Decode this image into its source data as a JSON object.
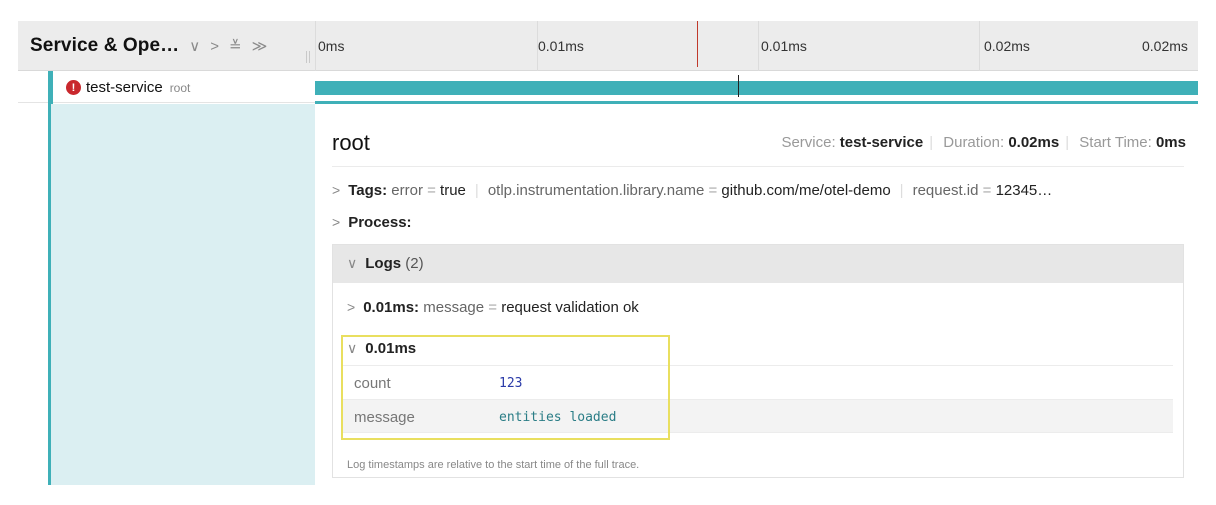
{
  "header": {
    "title": "Service & Ope…",
    "controls": {
      "collapse_one": "∨",
      "expand_one": ">",
      "collapse_all": "≚",
      "expand_all": "≫"
    },
    "ticks": [
      "0ms",
      "0.01ms",
      "0.01ms",
      "0.02ms",
      "0.02ms"
    ]
  },
  "span": {
    "service": "test-service",
    "operation": "root",
    "has_error": true,
    "bar_color": "#3fb0b8"
  },
  "detail": {
    "title": "root",
    "service_label": "Service:",
    "service_value": "test-service",
    "duration_label": "Duration:",
    "duration_value": "0.02ms",
    "start_label": "Start Time:",
    "start_value": "0ms",
    "tags_label": "Tags:",
    "tags": [
      {
        "key": "error",
        "value": "true"
      },
      {
        "key": "otlp.instrumentation.library.name",
        "value": "github.com/me/otel-demo"
      },
      {
        "key": "request.id",
        "value": "12345…"
      }
    ],
    "process_label": "Process:",
    "logs": {
      "label": "Logs",
      "count": "(2)",
      "entries": [
        {
          "time": "0.01ms:",
          "key": "message",
          "value": "request validation ok"
        },
        {
          "time": "0.01ms",
          "fields": [
            {
              "key": "count",
              "value": "123",
              "color": "#2a3aa8"
            },
            {
              "key": "message",
              "value": "entities loaded",
              "color": "#2a7d86"
            }
          ]
        }
      ],
      "note": "Log timestamps are relative to the start time of the full trace."
    }
  },
  "colors": {
    "accent": "#3fb0b8",
    "error": "#c9282d",
    "cursor": "#c0392b",
    "highlight": "#e9df5f"
  }
}
